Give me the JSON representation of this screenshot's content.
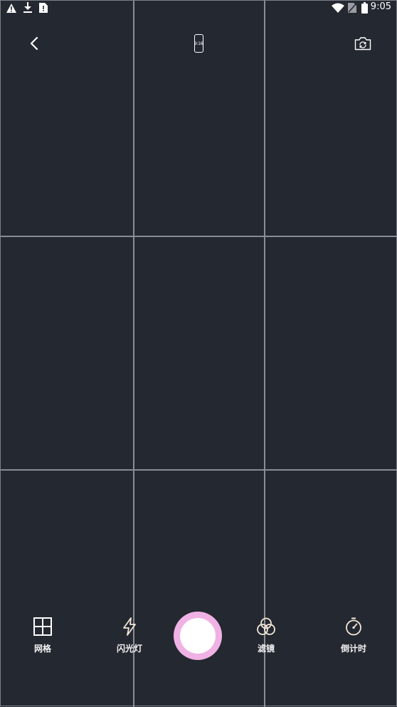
{
  "status_bar": {
    "time": "9:05",
    "left_icons": [
      "warning-icon",
      "download-icon",
      "sim-alert-icon"
    ],
    "right_icons": [
      "wifi-icon",
      "no-sim-icon",
      "battery-icon"
    ]
  },
  "top_bar": {
    "back_icon": "chevron-left-icon",
    "aspect_ratio": "9:16",
    "switch_camera_icon": "camera-switch-icon"
  },
  "toolbar": {
    "grid": {
      "label": "网格",
      "icon": "grid-icon"
    },
    "flash": {
      "label": "闪光灯",
      "icon": "flash-icon"
    },
    "filter": {
      "label": "滤镜",
      "icon": "filter-icon"
    },
    "timer": {
      "label": "倒计时",
      "icon": "timer-icon"
    }
  },
  "colors": {
    "background": "#242830",
    "grid_line": "#8a8d94",
    "shutter_ring": "#f0b2e4",
    "shutter_core": "#ffffff",
    "icon_tint": "#f2e6d8"
  }
}
